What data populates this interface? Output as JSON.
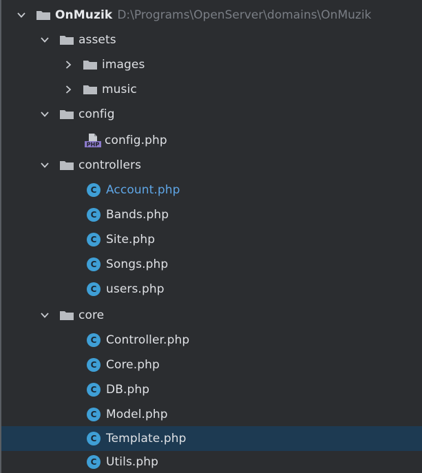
{
  "project": {
    "name": "OnMuzik",
    "path": "D:\\Programs\\OpenServer\\domains\\OnMuzik"
  },
  "tree": [
    {
      "label": "assets",
      "type": "folder",
      "state": "expanded"
    },
    {
      "label": "images",
      "type": "folder",
      "state": "collapsed"
    },
    {
      "label": "music",
      "type": "folder",
      "state": "collapsed"
    },
    {
      "label": "config",
      "type": "folder",
      "state": "expanded"
    },
    {
      "label": "config.php",
      "type": "php-file"
    },
    {
      "label": "controllers",
      "type": "folder",
      "state": "expanded"
    },
    {
      "label": "Account.php",
      "type": "class-file"
    },
    {
      "label": "Bands.php",
      "type": "class-file"
    },
    {
      "label": "Site.php",
      "type": "class-file"
    },
    {
      "label": "Songs.php",
      "type": "class-file"
    },
    {
      "label": "users.php",
      "type": "class-file"
    },
    {
      "label": "core",
      "type": "folder",
      "state": "expanded"
    },
    {
      "label": "Controller.php",
      "type": "class-file"
    },
    {
      "label": "Core.php",
      "type": "class-file"
    },
    {
      "label": "DB.php",
      "type": "class-file"
    },
    {
      "label": "Model.php",
      "type": "class-file"
    },
    {
      "label": "Template.php",
      "type": "class-file",
      "selected": true
    },
    {
      "label": "Utils.php",
      "type": "class-file"
    }
  ],
  "icons": {
    "class_letter": "C",
    "php_badge": "PHP"
  },
  "colors": {
    "background": "#2b2d30",
    "selection": "#1d3a52",
    "class_icon": "#3f9fd6",
    "folder": "#b9bcc1",
    "highlight_text": "#5fa6e6",
    "path_text": "#7a7e85"
  }
}
